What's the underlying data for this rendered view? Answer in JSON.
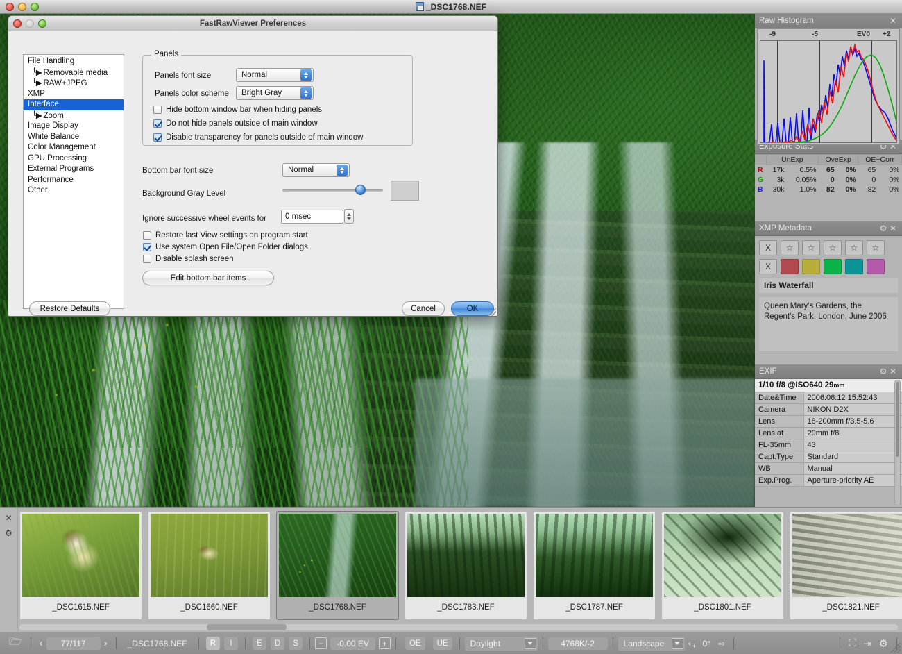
{
  "window": {
    "title": "_DSC1768.NEF",
    "doc_icon": "document-icon"
  },
  "dialog": {
    "title": "FastRawViewer Preferences",
    "sidebar": [
      {
        "label": "File Handling",
        "child": false,
        "selected": false
      },
      {
        "label": "Removable media",
        "child": true,
        "selected": false
      },
      {
        "label": "RAW+JPEG",
        "child": true,
        "selected": false
      },
      {
        "label": "XMP",
        "child": false,
        "selected": false
      },
      {
        "label": "Interface",
        "child": false,
        "selected": true
      },
      {
        "label": "Zoom",
        "child": true,
        "selected": false
      },
      {
        "label": "Image Display",
        "child": false,
        "selected": false
      },
      {
        "label": "White Balance",
        "child": false,
        "selected": false
      },
      {
        "label": "Color Management",
        "child": false,
        "selected": false
      },
      {
        "label": "GPU Processing",
        "child": false,
        "selected": false
      },
      {
        "label": "External Programs",
        "child": false,
        "selected": false
      },
      {
        "label": "Performance",
        "child": false,
        "selected": false
      },
      {
        "label": "Other",
        "child": false,
        "selected": false
      }
    ],
    "panels_group": {
      "title": "Panels",
      "font_size_label": "Panels font size",
      "font_size_value": "Normal",
      "color_scheme_label": "Panels color scheme",
      "color_scheme_value": "Bright Gray",
      "checkboxes": [
        {
          "label": "Hide bottom window bar when hiding panels",
          "checked": false
        },
        {
          "label": "Do not hide panels outside of main window",
          "checked": true
        },
        {
          "label": "Disable transparency for panels outside of main window",
          "checked": true
        }
      ]
    },
    "bottom_bar_font_label": "Bottom bar font size",
    "bottom_bar_font_value": "Normal",
    "bg_gray_label": "Background Gray Level",
    "bg_gray_swatch_color": "#cfcfcf",
    "wheel_label": "Ignore successive wheel events for",
    "wheel_value": "0 msec",
    "options": [
      {
        "label": "Restore last View settings on program start",
        "checked": false
      },
      {
        "label": "Use system Open File/Open Folder dialogs",
        "checked": true
      },
      {
        "label": "Disable splash screen",
        "checked": false
      }
    ],
    "edit_bottom_bar_label": "Edit bottom bar items",
    "restore_defaults_label": "Restore Defaults",
    "cancel_label": "Cancel",
    "ok_label": "OK"
  },
  "panels": {
    "histogram": {
      "title": "Raw Histogram",
      "close_icon": "close-icon",
      "axis_labels": [
        "-9",
        "-5",
        "EV0",
        "+2"
      ]
    },
    "exposure": {
      "title": "Exposure Stats",
      "gear_icon": "gear-icon",
      "close_icon": "close-icon",
      "columns": [
        "",
        "UnExp",
        "OveExp",
        "OE+Corr"
      ],
      "rows": [
        {
          "channel": "R",
          "color": "#d00000",
          "unexp_n": "17k",
          "unexp_p": "0.5%",
          "ovexp_n": "65",
          "ovexp_p": "0%",
          "oecorr_n": "65",
          "oecorr_p": "0%"
        },
        {
          "channel": "G",
          "color": "#00a000",
          "unexp_n": "3k",
          "unexp_p": "0.05%",
          "ovexp_n": "0",
          "ovexp_p": "0%",
          "oecorr_n": "0",
          "oecorr_p": "0%"
        },
        {
          "channel": "B",
          "color": "#1a1aff",
          "unexp_n": "30k",
          "unexp_p": "1.0%",
          "ovexp_n": "82",
          "ovexp_p": "0%",
          "oecorr_n": "82",
          "oecorr_p": "0%"
        }
      ]
    },
    "xmp": {
      "title": "XMP Metadata",
      "gear_icon": "gear-icon",
      "close_icon": "close-icon",
      "rating_clear": "X",
      "rating_stars": [
        "☆",
        "☆",
        "☆",
        "☆",
        "☆"
      ],
      "label_clear": "X",
      "label_colors": [
        "#b04a4e",
        "#b8ac3a",
        "#09b347",
        "#0b9496",
        "#b259a8"
      ],
      "image_title": "Iris Waterfall",
      "description": "Queen Mary's Gardens, the Regent's Park, London, June 2006"
    },
    "exif": {
      "title": "EXIF",
      "gear_icon": "gear-icon",
      "close_icon": "close-icon",
      "summary_main": "1/10 f/8 @ISO640 29",
      "summary_unit": "mm",
      "rows": [
        {
          "key": "Date&Time",
          "value": "2006:06:12 15:52:43"
        },
        {
          "key": "Camera",
          "value": "NIKON D2X"
        },
        {
          "key": "Lens",
          "value": "18-200mm f/3.5-5.6"
        },
        {
          "key": "Lens at",
          "value": "29mm f/8"
        },
        {
          "key": "FL-35mm",
          "value": "43"
        },
        {
          "key": "Capt.Type",
          "value": "Standard"
        },
        {
          "key": "WB",
          "value": "Manual"
        },
        {
          "key": "Exp.Prog.",
          "value": "Aperture-priority AE"
        }
      ]
    }
  },
  "filmstrip": {
    "close_icon": "close-icon",
    "gear_icon": "gear-icon",
    "items": [
      {
        "name": "_DSC1615.NEF",
        "art": "t-duck1",
        "selected": false
      },
      {
        "name": "_DSC1660.NEF",
        "art": "t-duck2",
        "selected": false
      },
      {
        "name": "_DSC1768.NEF",
        "art": "t-falls",
        "selected": true
      },
      {
        "name": "_DSC1783.NEF",
        "art": "t-trees1",
        "selected": false
      },
      {
        "name": "_DSC1787.NEF",
        "art": "t-trees2",
        "selected": false
      },
      {
        "name": "_DSC1801.NEF",
        "art": "t-branch",
        "selected": false
      },
      {
        "name": "_DSC1821.NEF",
        "art": "t-logs",
        "selected": false
      }
    ]
  },
  "bottom_bar": {
    "folder_icon": "folder-icon",
    "prev_label": "‹",
    "counter": "77/117",
    "next_label": "›",
    "filename": "_DSC1768.NEF",
    "toggle_r": "R",
    "toggle_i": "I",
    "toggle_e": "E",
    "toggle_d": "D",
    "toggle_s": "S",
    "ev_minus": "−",
    "ev_value": "-0.00 EV",
    "ev_plus": "+",
    "oe_label": "OE",
    "ue_label": "UE",
    "wb_preset": "Daylight",
    "wb_temp": "4768K/-2",
    "orientation": "Landscape",
    "rotate_cw_icon": "rotate-cw-icon",
    "rotate_angle": "0°",
    "rotate_ccw_icon": "rotate-ccw-icon",
    "fit_icon": "fit-screen-icon",
    "panel_icon": "toggle-panel-icon",
    "settings_icon": "gear-icon"
  }
}
